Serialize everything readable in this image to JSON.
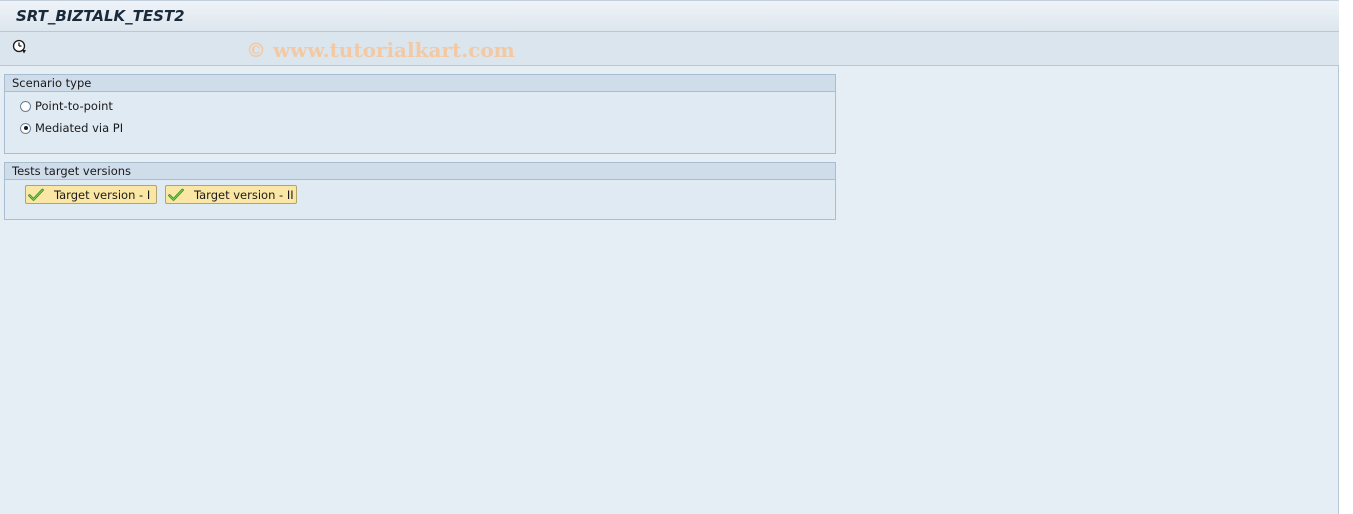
{
  "window": {
    "title": "SRT_BIZTALK_TEST2"
  },
  "toolbar": {
    "execute_icon": "execute-clock-icon",
    "watermark": "© www.tutorialkart.com"
  },
  "scenario_group": {
    "title": "Scenario type",
    "options": [
      {
        "label": "Point-to-point",
        "selected": false
      },
      {
        "label": "Mediated via PI",
        "selected": true
      }
    ]
  },
  "tests_group": {
    "title": "Tests target versions",
    "buttons": [
      {
        "label": "Target version - I",
        "icon": "checkmark-icon"
      },
      {
        "label": "Target version - II",
        "icon": "checkmark-icon"
      }
    ]
  },
  "colors": {
    "background": "#e6eef5",
    "button_yellow": "#fbe7a5",
    "check_green": "#2e8b1f",
    "watermark": "#f3c9a4"
  }
}
